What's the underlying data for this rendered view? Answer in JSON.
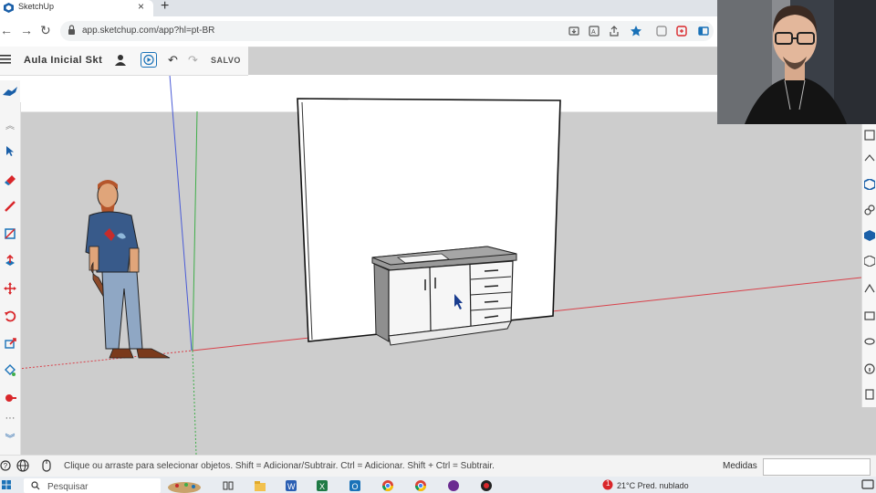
{
  "browser": {
    "tab_title": "SketchUp",
    "url": "app.sketchup.com/app?hl=pt-BR"
  },
  "header": {
    "document_title": "Aula Inicial Skt",
    "save_status": "SALVO"
  },
  "status_bar": {
    "hint": "Clique ou arraste para selecionar objetos. Shift = Adicionar/Subtrair. Ctrl = Adicionar. Shift + Ctrl = Subtrair.",
    "measure_label": "Medidas",
    "measure_value": ""
  },
  "taskbar": {
    "search_placeholder": "Pesquisar",
    "weather": "21°C  Pred. nublado",
    "notification_count": "1"
  },
  "colors": {
    "accent": "#1a72b8",
    "tool_red": "#d9262a",
    "axis_red": "#d8414a",
    "axis_green": "#3fae49",
    "axis_blue": "#4a5bd6"
  },
  "icons": {
    "left_toolbar": [
      "select-icon",
      "eraser-icon",
      "pencil-icon",
      "rectangle-icon",
      "push-pull-icon",
      "move-icon",
      "rotate-icon",
      "scale-icon",
      "paint-bucket-icon",
      "tape-measure-icon",
      "more-icon",
      "expand-down-icon"
    ],
    "right_toolbar": [
      "components-icon",
      "materials-icon",
      "styles-icon",
      "layers-icon",
      "scenes-icon",
      "outliner-icon",
      "instructor-icon",
      "display-icon",
      "shadows-icon",
      "info-icon",
      "models-icon"
    ]
  }
}
